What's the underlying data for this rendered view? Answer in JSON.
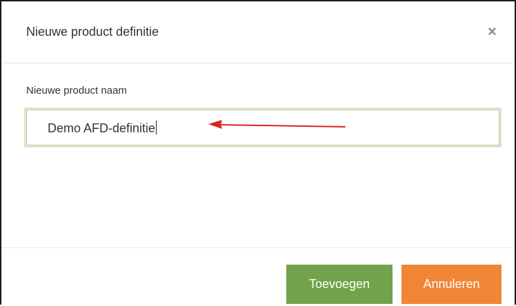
{
  "dialog": {
    "title": "Nieuwe product definitie",
    "close_glyph": "×",
    "close_icon": "close-icon"
  },
  "form": {
    "label": "Nieuwe product naam",
    "value": "Demo AFD-definitie"
  },
  "annotation": {
    "arrow_color": "#e02020",
    "arrow_icon": "red-arrow-annotation"
  },
  "buttons": {
    "add_label": "Toevoegen",
    "cancel_label": "Annuleren"
  },
  "colors": {
    "add_button": "#73a24c",
    "cancel_button": "#ef8535",
    "input_focus_border": "#b9cf9e"
  }
}
